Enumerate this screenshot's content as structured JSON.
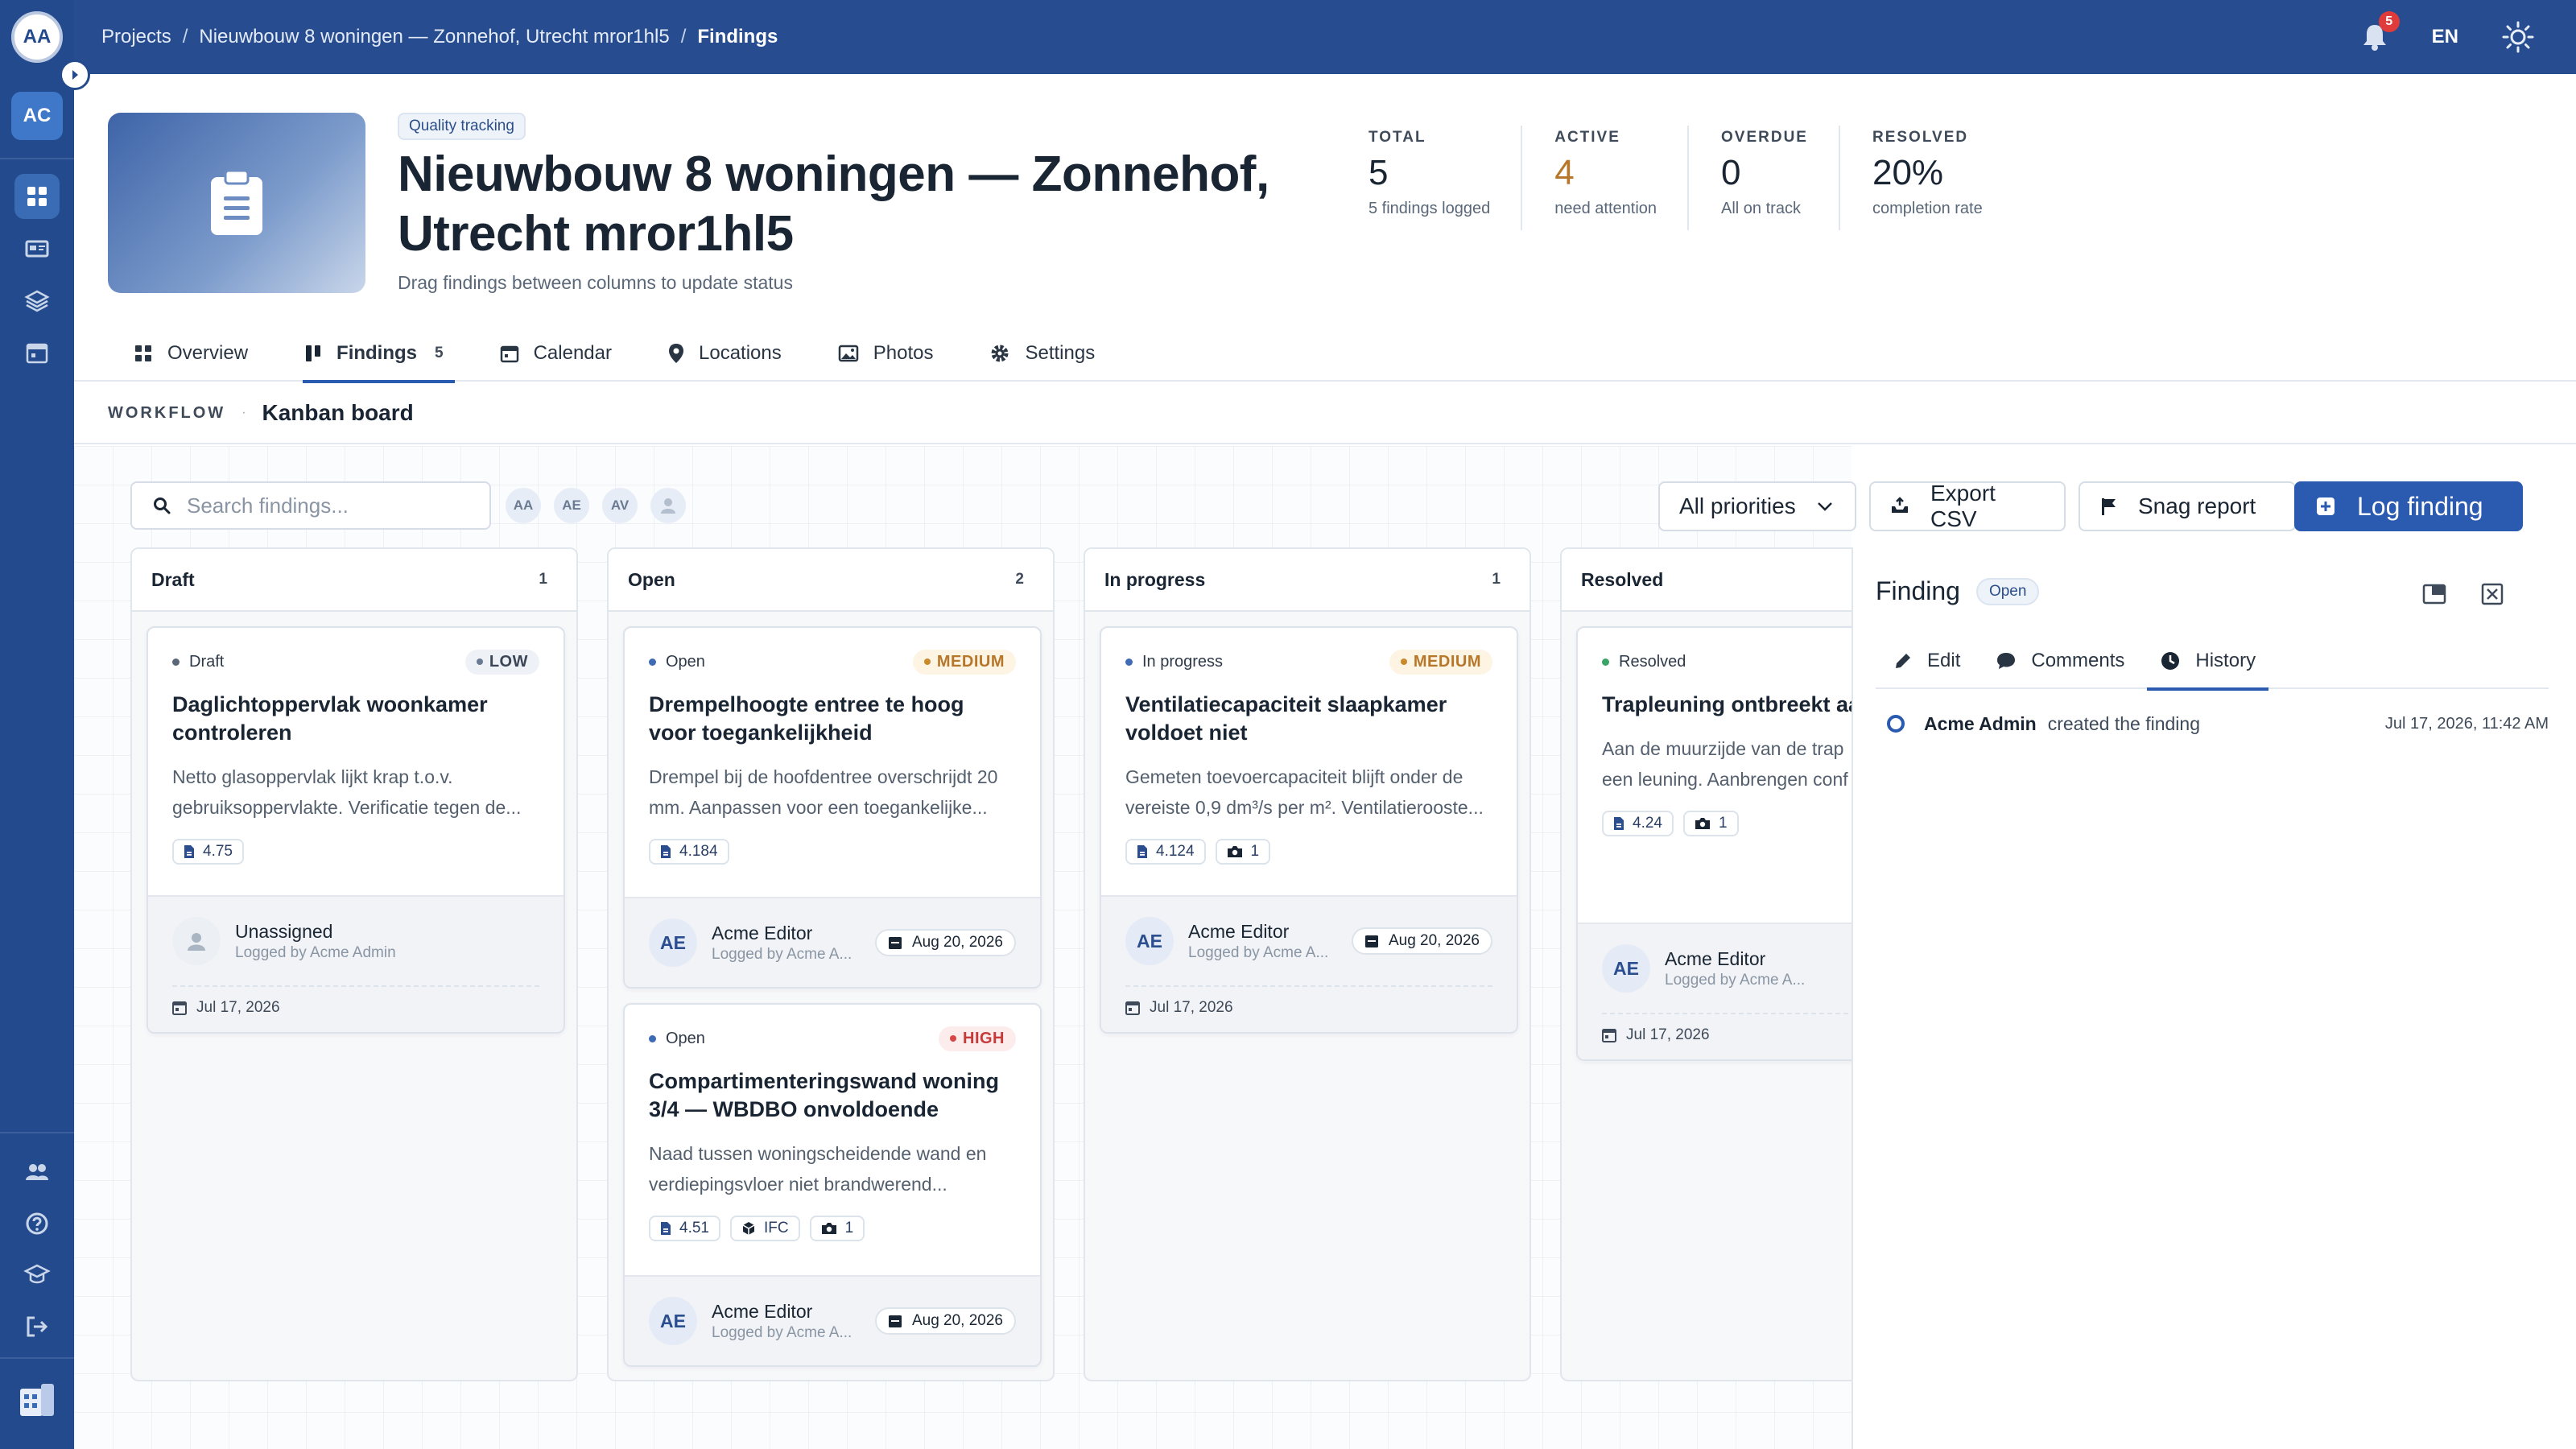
{
  "sidebar": {
    "user_initials": "AA",
    "org_initials": "AC",
    "nav": [
      "dashboard-icon",
      "cards-icon",
      "layers-icon",
      "calendar-icon"
    ],
    "bottom": [
      "users-icon",
      "help-icon",
      "academy-icon",
      "logout-icon"
    ]
  },
  "topbar": {
    "breadcrumb": [
      "Projects",
      "Nieuwbouw 8 woningen — Zonnehof, Utrecht mror1hl5",
      "Findings"
    ],
    "notifications": "5",
    "language": "EN"
  },
  "header": {
    "badge": "Quality tracking",
    "title": "Nieuwbouw 8 woningen — Zonnehof, Utrecht mror1hl5",
    "subtitle": "Drag findings between columns to update status",
    "stats": [
      {
        "label": "TOTAL",
        "value": "5",
        "hint": "5 findings logged"
      },
      {
        "label": "ACTIVE",
        "value": "4",
        "hint": "need attention"
      },
      {
        "label": "OVERDUE",
        "value": "0",
        "hint": "All on track"
      },
      {
        "label": "RESOLVED",
        "value": "20%",
        "hint": "completion rate"
      }
    ]
  },
  "tabs": [
    {
      "label": "Overview"
    },
    {
      "label": "Findings",
      "count": "5"
    },
    {
      "label": "Calendar"
    },
    {
      "label": "Locations"
    },
    {
      "label": "Photos"
    },
    {
      "label": "Settings"
    }
  ],
  "workflow": {
    "label": "WORKFLOW",
    "title": "Kanban board"
  },
  "toolbar": {
    "search_placeholder": "Search findings...",
    "avatars": [
      "AA",
      "AE",
      "AV"
    ],
    "priority_filter": "All priorities",
    "export_label": "Export CSV",
    "snag_label": "Snag report",
    "log_label": "Log finding"
  },
  "columns": [
    {
      "title": "Draft",
      "count": "1",
      "cards": [
        {
          "status": "Draft",
          "priority": "LOW",
          "title": "Daglichtoppervlak woonkamer controleren",
          "desc": "Netto glasoppervlak lijkt krap t.o.v. gebruiksoppervlakte. Verificatie tegen de...",
          "ref": "4.75",
          "assignee": "Unassigned",
          "logged_by": "Logged by Acme Admin",
          "created": "Jul 17, 2026"
        }
      ]
    },
    {
      "title": "Open",
      "count": "2",
      "cards": [
        {
          "status": "Open",
          "priority": "MEDIUM",
          "title": "Drempelhoogte entree te hoog voor toegankelijkheid",
          "desc": "Drempel bij de hoofdentree overschrijdt 20 mm. Aanpassen voor een toegankelijke...",
          "ref": "4.184",
          "assignee_initials": "AE",
          "assignee": "Acme Editor",
          "logged_by": "Logged by Acme A...",
          "due": "Aug 20, 2026"
        },
        {
          "status": "Open",
          "priority": "HIGH",
          "title": "Compartimenteringswand woning 3/4 — WBDBO onvoldoende",
          "desc": "Naad tussen woningscheidende wand en verdiepingsvloer niet brandwerend...",
          "ref": "4.51",
          "ifc": "IFC",
          "photos": "1",
          "assignee_initials": "AE",
          "assignee": "Acme Editor",
          "logged_by": "Logged by Acme A...",
          "due": "Aug 20, 2026"
        }
      ]
    },
    {
      "title": "In progress",
      "count": "1",
      "cards": [
        {
          "status": "In progress",
          "priority": "MEDIUM",
          "title": "Ventilatiecapaciteit slaapkamer voldoet niet",
          "desc": "Gemeten toevoercapaciteit blijft onder de vereiste 0,9 dm³/s per m². Ventilatierooste...",
          "ref": "4.124",
          "photos": "1",
          "assignee_initials": "AE",
          "assignee": "Acme Editor",
          "logged_by": "Logged by Acme A...",
          "due": "Aug 20, 2026",
          "created": "Jul 17, 2026"
        }
      ]
    },
    {
      "title": "Resolved",
      "count": "",
      "cards": [
        {
          "status": "Resolved",
          "title": "Trapleuning ontbreekt aan",
          "desc": "Aan de muurzijde van de trap een leuning. Aanbrengen conf",
          "ref": "4.24",
          "photos": "1",
          "assignee_initials": "AE",
          "assignee": "Acme Editor",
          "logged_by": "Logged by Acme A...",
          "created": "Jul 17, 2026"
        }
      ]
    }
  ],
  "panel": {
    "title": "Finding",
    "status": "Open",
    "tabs": [
      "Edit",
      "Comments",
      "History"
    ],
    "history": [
      {
        "actor": "Acme Admin",
        "action": "created the finding",
        "time": "Jul 17, 2026, 11:42 AM"
      }
    ]
  },
  "colors": {
    "brand": "#274d90",
    "primary": "#2a5bb0",
    "medium": "#b7772a",
    "high": "#c63a3a",
    "resolved": "#3aa366"
  }
}
